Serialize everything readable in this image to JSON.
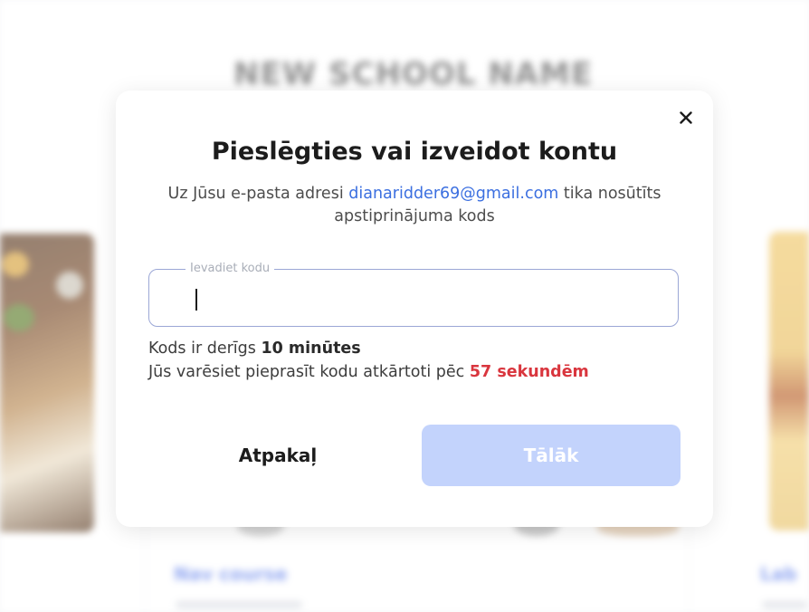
{
  "background": {
    "school_name": "NEW SCHOOL NAME",
    "course_link_left": "Nav course",
    "course_link_right": "Lab"
  },
  "modal": {
    "title": "Pieslēgties vai izveidot kontu",
    "subtitle_prefix": "Uz Jūsu e-pasta adresi",
    "email": "dianaridder69@gmail.com",
    "subtitle_suffix": "tika nosūtīts apstiprinājuma kods",
    "code_field": {
      "label": "Ievadiet kodu",
      "value": ""
    },
    "validity_prefix": "Kods ir derīgs",
    "validity_value": "10 minūtes",
    "resend_prefix": "Jūs varēsiet pieprasīt kodu atkārtoti pēc",
    "resend_countdown": "57 sekundēm",
    "back_label": "Atpakaļ",
    "next_label": "Tālāk",
    "close_icon": "close-icon"
  },
  "colors": {
    "accent": "#3b6fe0",
    "countdown": "#d9363e",
    "next_button_disabled": "#c3d3fc",
    "field_border": "#9ba7d6"
  }
}
